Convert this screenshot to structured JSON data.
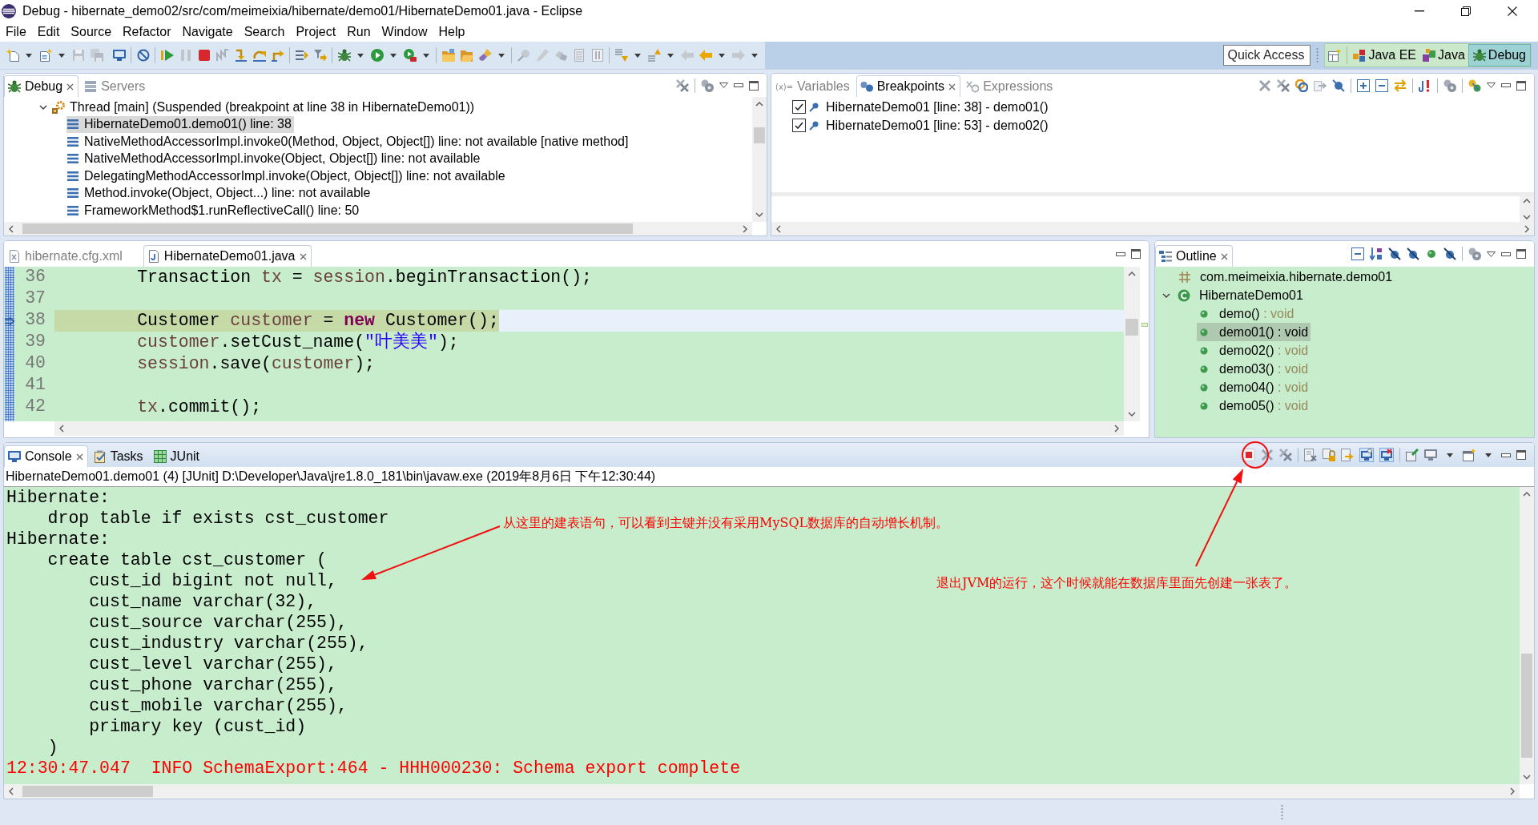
{
  "window": {
    "title": "Debug - hibernate_demo02/src/com/meimeixia/hibernate/demo01/HibernateDemo01.java - Eclipse"
  },
  "menu": [
    "File",
    "Edit",
    "Source",
    "Refactor",
    "Navigate",
    "Search",
    "Project",
    "Run",
    "Window",
    "Help"
  ],
  "toolbar": {
    "quick_access": {
      "placeholder": "Quick Access"
    },
    "perspectives": [
      {
        "label": "Java EE",
        "kind": "javaee",
        "selected": false
      },
      {
        "label": "Java",
        "kind": "java",
        "selected": false
      },
      {
        "label": "Debug",
        "kind": "debug",
        "selected": true
      }
    ]
  },
  "debug_view": {
    "active": false,
    "tabs": [
      {
        "label": "Debug",
        "kind": "debug",
        "selected": true
      },
      {
        "label": "Servers",
        "kind": "servers",
        "selected": false
      }
    ],
    "tree": [
      {
        "label": "Thread [main] (Suspended (breakpoint at line 38 in HibernateDemo01))",
        "expanded": true,
        "children": [
          {
            "label": "HibernateDemo01.demo01() line: 38",
            "selected": true
          },
          {
            "label": "NativeMethodAccessorImpl.invoke0(Method, Object, Object[]) line: not available [native method]",
            "selected": false
          },
          {
            "label": "NativeMethodAccessorImpl.invoke(Object, Object[]) line: not available",
            "selected": false
          },
          {
            "label": "DelegatingMethodAccessorImpl.invoke(Object, Object[]) line: not available",
            "selected": false
          },
          {
            "label": "Method.invoke(Object, Object...) line: not available",
            "selected": false
          },
          {
            "label": "FrameworkMethod$1.runReflectiveCall() line: 50",
            "selected": false
          }
        ]
      }
    ]
  },
  "breakpoints_view": {
    "active": false,
    "tabs": [
      {
        "label": "Variables",
        "kind": "variables",
        "icon_text": "(x)=",
        "selected": false
      },
      {
        "label": "Breakpoints",
        "kind": "breakpoints",
        "selected": true
      },
      {
        "label": "Expressions",
        "kind": "expressions",
        "selected": false
      }
    ],
    "breakpoints": [
      {
        "label": "HibernateDemo01 [line: 38] - demo01()",
        "checked": true
      },
      {
        "label": "HibernateDemo01 [line: 53] - demo02()",
        "checked": true
      }
    ]
  },
  "editor": {
    "active": false,
    "tabs": [
      {
        "label": "hibernate.cfg.xml",
        "kind": "xml",
        "selected": false
      },
      {
        "label": "HibernateDemo01.java",
        "kind": "java",
        "selected": true
      }
    ],
    "lines": [
      {
        "number": "36",
        "current": false,
        "tokens": [
          {
            "text": "        Transaction ",
            "kind": "plain"
          },
          {
            "text": "tx",
            "kind": "local"
          },
          {
            "text": " = ",
            "kind": "plain"
          },
          {
            "text": "session",
            "kind": "local"
          },
          {
            "text": ".beginTransaction();",
            "kind": "plain"
          }
        ]
      },
      {
        "number": "37",
        "current": false
      },
      {
        "number": "38",
        "current": true,
        "tokens": [
          {
            "text": "        Customer ",
            "kind": "plain"
          },
          {
            "text": "customer",
            "kind": "local"
          },
          {
            "text": " = ",
            "kind": "plain"
          },
          {
            "text": "new",
            "kind": "keyword"
          },
          {
            "text": " Customer();",
            "kind": "plain"
          }
        ]
      },
      {
        "number": "39",
        "current": false,
        "tokens": [
          {
            "text": "        customer",
            "kind": "local"
          },
          {
            "text": ".setCust_name(",
            "kind": "plain"
          },
          {
            "text": "\"叶美美\"",
            "kind": "string"
          },
          {
            "text": ");",
            "kind": "plain"
          }
        ]
      },
      {
        "number": "40",
        "current": false,
        "tokens": [
          {
            "text": "        session",
            "kind": "local"
          },
          {
            "text": ".save(",
            "kind": "plain"
          },
          {
            "text": "customer",
            "kind": "local"
          },
          {
            "text": ");",
            "kind": "plain"
          }
        ]
      },
      {
        "number": "41",
        "current": false
      },
      {
        "number": "42",
        "current": false,
        "tokens": [
          {
            "text": "        tx",
            "kind": "local"
          },
          {
            "text": ".commit();",
            "kind": "plain"
          }
        ]
      }
    ]
  },
  "outline": {
    "active": false,
    "tabs": [
      {
        "label": "Outline",
        "kind": "outline",
        "selected": true
      }
    ],
    "tree": [
      {
        "label": "com.meimeixia.hibernate.demo01",
        "kind": "package"
      },
      {
        "label": "HibernateDemo01",
        "kind": "class",
        "expanded": true,
        "children": [
          {
            "label": "demo()",
            "type": ": void",
            "selected": false
          },
          {
            "label": "demo01()",
            "type": ": void",
            "selected": true
          },
          {
            "label": "demo02()",
            "type": ": void",
            "selected": false
          },
          {
            "label": "demo03()",
            "type": ": void",
            "selected": false
          },
          {
            "label": "demo04()",
            "type": ": void",
            "selected": false
          },
          {
            "label": "demo05()",
            "type": ": void",
            "selected": false
          }
        ]
      }
    ]
  },
  "console": {
    "active": true,
    "tabs": [
      {
        "label": "Console",
        "kind": "console",
        "selected": true
      },
      {
        "label": "Tasks",
        "kind": "tasks",
        "selected": false
      },
      {
        "label": "JUnit",
        "kind": "junit",
        "selected": false
      }
    ],
    "process": "HibernateDemo01.demo01 (4) [JUnit] D:\\Developer\\Java\\jre1.8.0_181\\bin\\javaw.exe (2019年8月6日 下午12:30:44)",
    "lines": [
      {
        "text": "Hibernate:",
        "kind": "stdout"
      },
      {
        "text": "    drop table if exists cst_customer",
        "kind": "stdout"
      },
      {
        "text": "Hibernate:",
        "kind": "stdout"
      },
      {
        "text": "    create table cst_customer (",
        "kind": "stdout"
      },
      {
        "text": "        cust_id bigint not null,",
        "kind": "stdout"
      },
      {
        "text": "        cust_name varchar(32),",
        "kind": "stdout"
      },
      {
        "text": "        cust_source varchar(255),",
        "kind": "stdout"
      },
      {
        "text": "        cust_industry varchar(255),",
        "kind": "stdout"
      },
      {
        "text": "        cust_level varchar(255),",
        "kind": "stdout"
      },
      {
        "text": "        cust_phone varchar(255),",
        "kind": "stdout"
      },
      {
        "text": "        cust_mobile varchar(255),",
        "kind": "stdout"
      },
      {
        "text": "        primary key (cust_id)",
        "kind": "stdout"
      },
      {
        "text": "    )",
        "kind": "stdout"
      },
      {
        "text": "12:30:47.047  INFO SchemaExport:464 - HHH000230: Schema export complete",
        "kind": "stderr"
      }
    ]
  },
  "annotations": [
    {
      "text": "从这里的建表语句，可以看到主键并没有采用MySQL数据库的自动增长机制。"
    },
    {
      "text": "退出JVM的运行，这个时候就能在数据库里面先创建一张表了。"
    }
  ]
}
